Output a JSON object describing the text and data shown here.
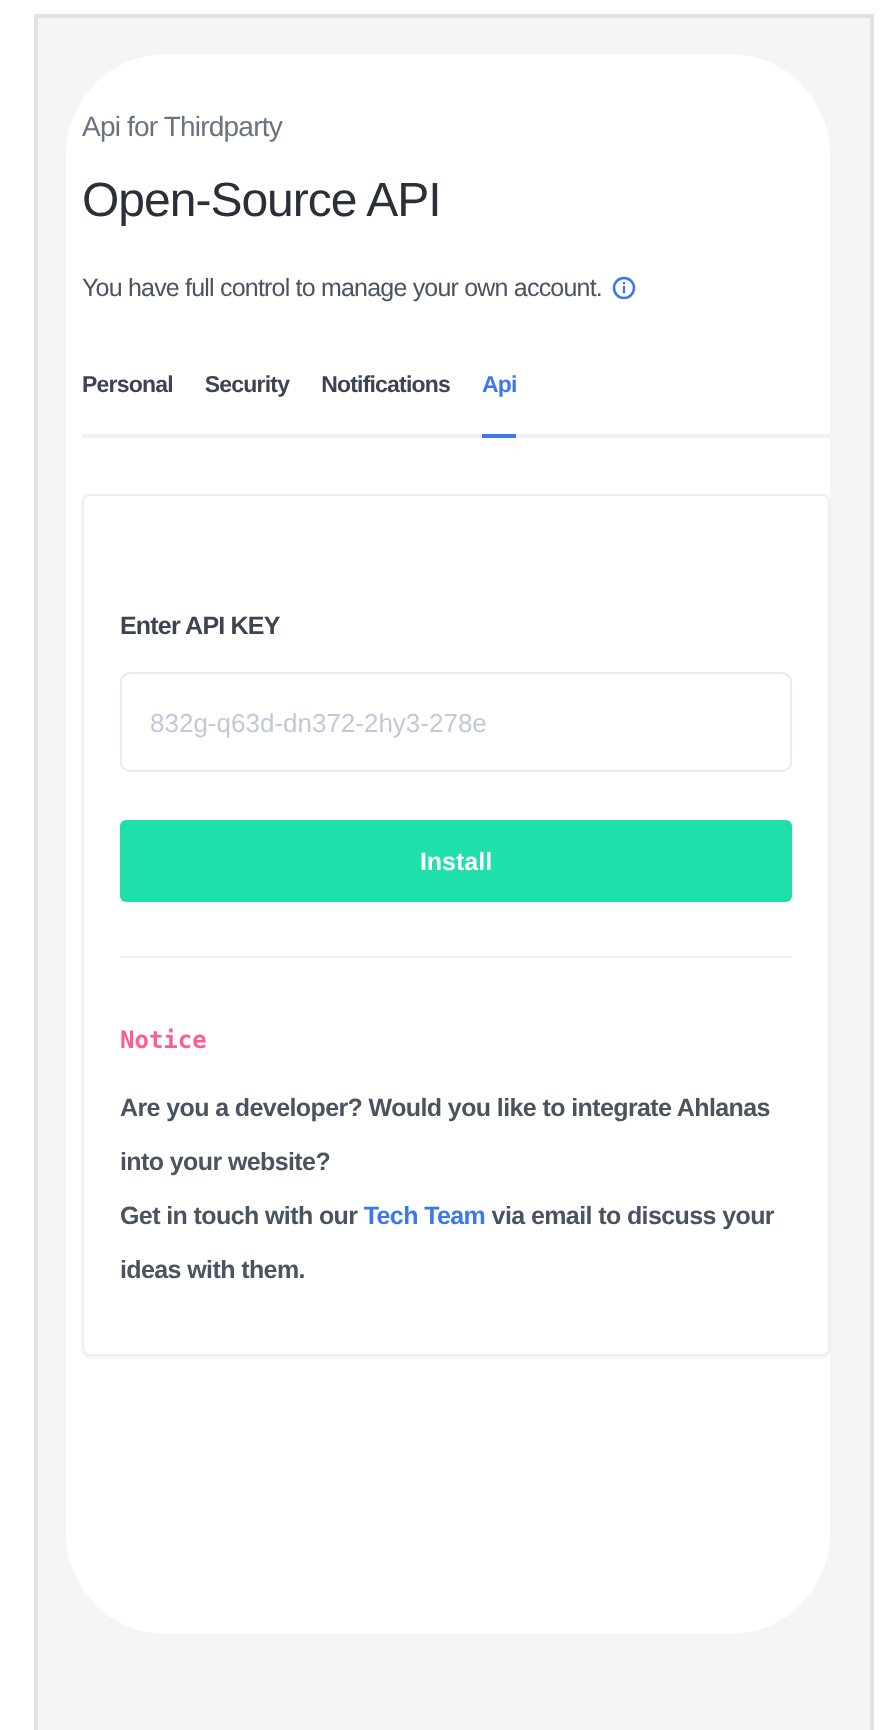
{
  "header": {
    "eyebrow": "Api for Thirdparty",
    "title": "Open-Source API",
    "subtitle": "You have full control to manage your own account."
  },
  "tabs": [
    {
      "label": "Personal",
      "selected": false
    },
    {
      "label": "Security",
      "selected": false
    },
    {
      "label": "Notifications",
      "selected": false
    },
    {
      "label": "Api",
      "selected": true
    }
  ],
  "form": {
    "label": "Enter API KEY",
    "placeholder": "832g-q63d-dn372-2hy3-278e",
    "button": "Install"
  },
  "notice": {
    "title": "Notice",
    "question": "Are you a developer? Would you like to integrate Ahlanas into your website?",
    "contact_before": "Get in touch with our ",
    "contact_link": "Tech Team",
    "contact_after": " via email to discuss your ideas with them."
  }
}
